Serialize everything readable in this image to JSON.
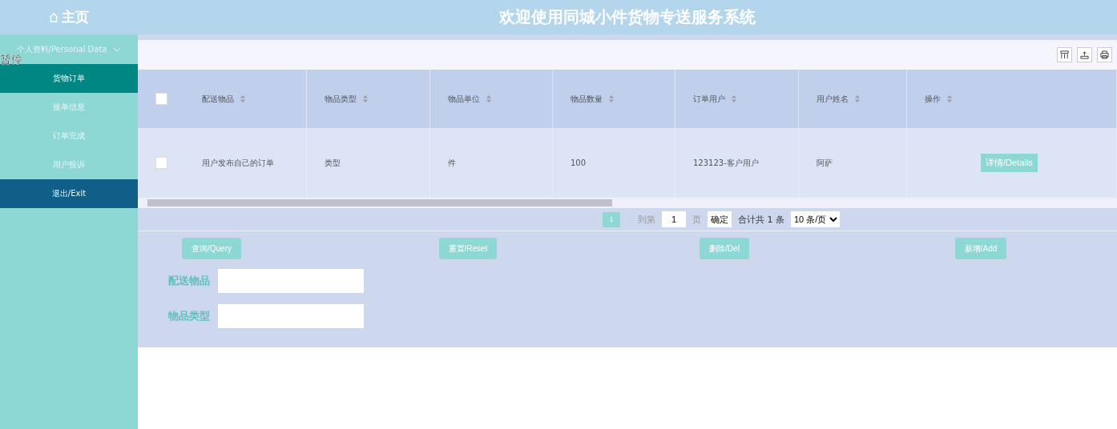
{
  "header": {
    "home_label": "主页",
    "title": "欢迎使用同城小件货物专送服务系统"
  },
  "overlay_text": "暂停",
  "sidebar": {
    "group": {
      "label": "个人资料/Personal Data",
      "expanded": false
    },
    "items": [
      {
        "label": "货物订单",
        "selected": true,
        "kind": "nav"
      },
      {
        "label": "接单信息",
        "selected": false,
        "kind": "nav"
      },
      {
        "label": "订单完成",
        "selected": false,
        "kind": "nav"
      },
      {
        "label": "用户投诉",
        "selected": false,
        "kind": "nav"
      },
      {
        "label": "退出/Exit",
        "selected": false,
        "kind": "exit"
      }
    ]
  },
  "table": {
    "all_checked": false,
    "columns": [
      "配送物品",
      "物品类型",
      "物品单位",
      "物品数量",
      "订单用户",
      "用户姓名",
      "操作"
    ],
    "rows": [
      {
        "checked": false,
        "cells": [
          "用户发布自己的订单",
          "类型",
          "件",
          "100",
          "123123-客户用户",
          "阿萨"
        ],
        "action": "详情/Details"
      }
    ]
  },
  "pagination": {
    "pages": [
      {
        "label": "1",
        "selected": true
      }
    ],
    "goto_label": "到第",
    "goto_value": "1",
    "page_unit": "页",
    "confirm": "确定",
    "total": "合计共 1 条",
    "page_size": "10 条/页"
  },
  "actions": [
    "查询/Query",
    "重置/Reset",
    "删除/Del",
    "新增/Add"
  ],
  "search_fields": [
    {
      "label": "配送物品"
    },
    {
      "label": "物品类型"
    }
  ]
}
